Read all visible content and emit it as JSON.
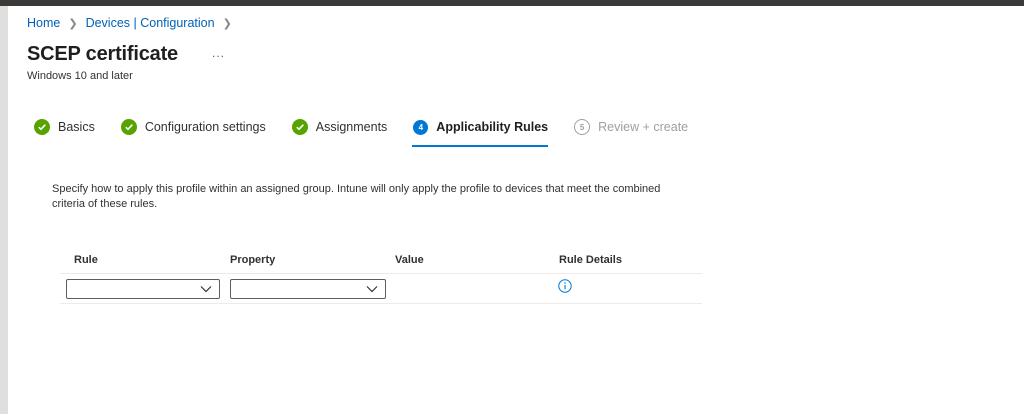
{
  "breadcrumb": [
    {
      "label": "Home"
    },
    {
      "label": "Devices | Configuration"
    }
  ],
  "header": {
    "title": "SCEP certificate",
    "more_label": "...",
    "subtitle": "Windows 10 and later"
  },
  "steps": [
    {
      "label": "Basics",
      "state": "complete"
    },
    {
      "label": "Configuration settings",
      "state": "complete"
    },
    {
      "label": "Assignments",
      "state": "complete"
    },
    {
      "label": "Applicability Rules",
      "state": "current",
      "number": "4"
    },
    {
      "label": "Review + create",
      "state": "pending",
      "number": "5"
    }
  ],
  "description": "Specify how to apply this profile within an assigned group. Intune will only apply the profile to devices that meet the combined criteria of these rules.",
  "rules_table": {
    "columns": [
      "Rule",
      "Property",
      "Value",
      "Rule Details"
    ],
    "rows": [
      {
        "rule": "",
        "property": "",
        "value": "",
        "details_icon": "info-icon"
      }
    ]
  },
  "colors": {
    "link": "#0062b5",
    "accent": "#0078d4",
    "success": "#57a300",
    "disabled": "#a19f9d"
  }
}
